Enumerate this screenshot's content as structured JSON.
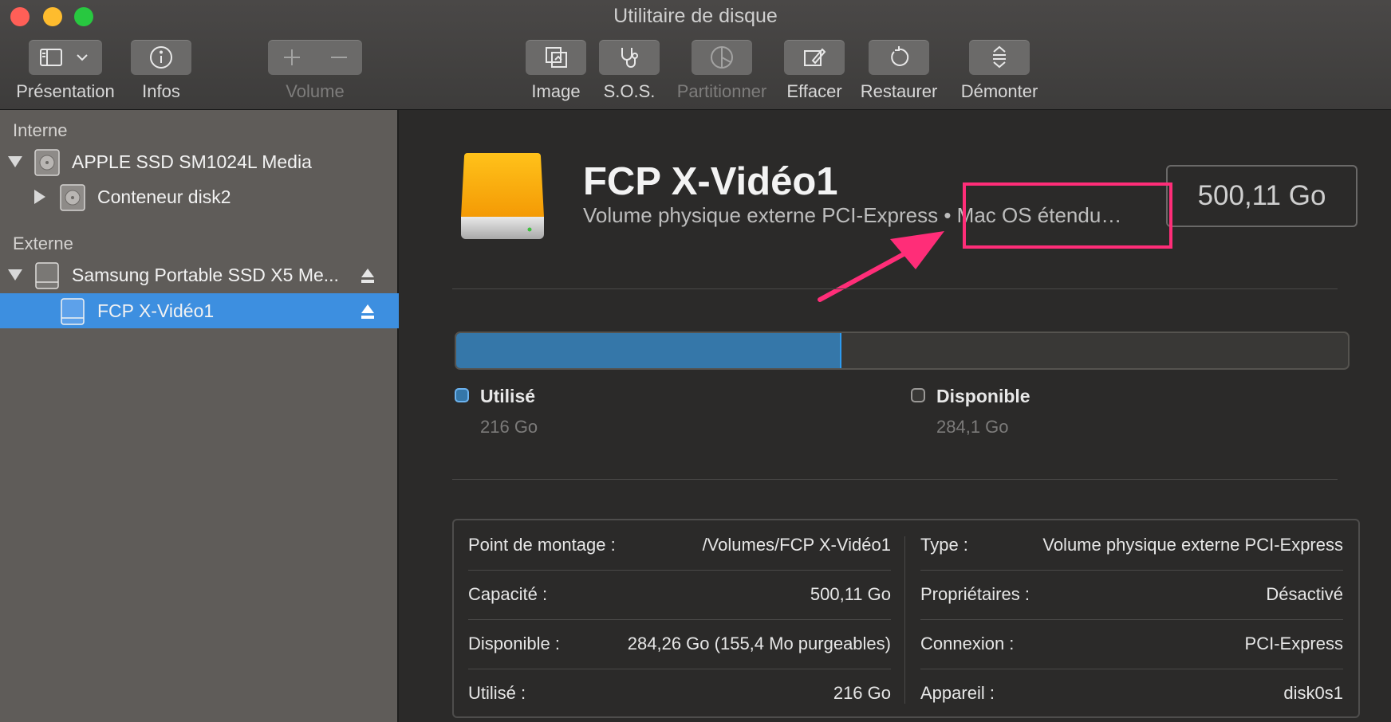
{
  "window": {
    "title": "Utilitaire de disque"
  },
  "toolbar": {
    "presentation": "Présentation",
    "infos": "Infos",
    "volume": "Volume",
    "image": "Image",
    "sos": "S.O.S.",
    "partition": "Partitionner",
    "erase": "Effacer",
    "restore": "Restaurer",
    "unmount": "Démonter"
  },
  "sidebar": {
    "internal_header": "Interne",
    "external_header": "Externe",
    "items": [
      {
        "label": "APPLE SSD SM1024L Media"
      },
      {
        "label": "Conteneur disk2"
      },
      {
        "label": "Samsung Portable SSD X5 Me..."
      },
      {
        "label": "FCP X-Vidéo1"
      }
    ]
  },
  "volume": {
    "name": "FCP X-Vidéo1",
    "subtitle": "Volume physique externe PCI-Express • Mac OS étendu…",
    "capacity": "500,11 Go"
  },
  "usage": {
    "used_fraction": 0.432,
    "used_label": "Utilisé",
    "used_value": "216 Go",
    "free_label": "Disponible",
    "free_value": "284,1 Go",
    "used_color": "#3577a9",
    "accent_color": "#2d9bf0",
    "highlight_color": "#ff2d78"
  },
  "info": {
    "left": [
      {
        "key": "Point de montage :",
        "value": "/Volumes/FCP X-Vidéo1"
      },
      {
        "key": "Capacité :",
        "value": "500,11 Go"
      },
      {
        "key": "Disponible :",
        "value": "284,26 Go (155,4 Mo purgeables)"
      },
      {
        "key": "Utilisé :",
        "value": "216 Go"
      }
    ],
    "right": [
      {
        "key": "Type :",
        "value": "Volume physique externe PCI-Express"
      },
      {
        "key": "Propriétaires :",
        "value": "Désactivé"
      },
      {
        "key": "Connexion :",
        "value": "PCI-Express"
      },
      {
        "key": "Appareil :",
        "value": "disk0s1"
      }
    ]
  }
}
